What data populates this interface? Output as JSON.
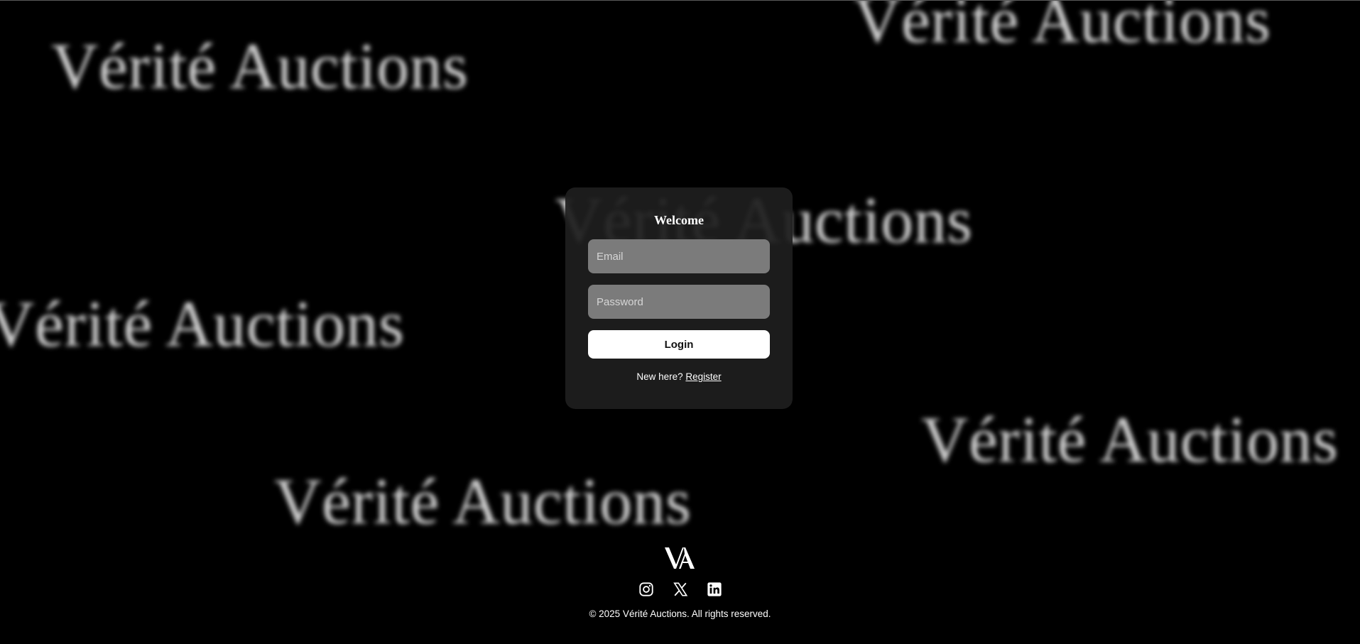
{
  "background": {
    "watermark_text": "Vérité Auctions",
    "color": "#000000"
  },
  "login": {
    "title": "Welcome",
    "email_placeholder": "Email",
    "password_placeholder": "Password",
    "login_label": "Login",
    "new_here_text": "New here?",
    "register_label": "Register"
  },
  "footer": {
    "logo_text": "VA",
    "socials": [
      {
        "name": "Instagram",
        "icon": "instagram-icon"
      },
      {
        "name": "X",
        "icon": "x-icon"
      },
      {
        "name": "LinkedIn",
        "icon": "linkedin-icon"
      }
    ],
    "copyright": "© 2025 Vérité Auctions. All rights reserved."
  },
  "colors": {
    "card_bg": "#1e1e1e",
    "field_bg": "#7b7b7b",
    "button_bg": "#ffffff",
    "text": "#ffffff"
  }
}
